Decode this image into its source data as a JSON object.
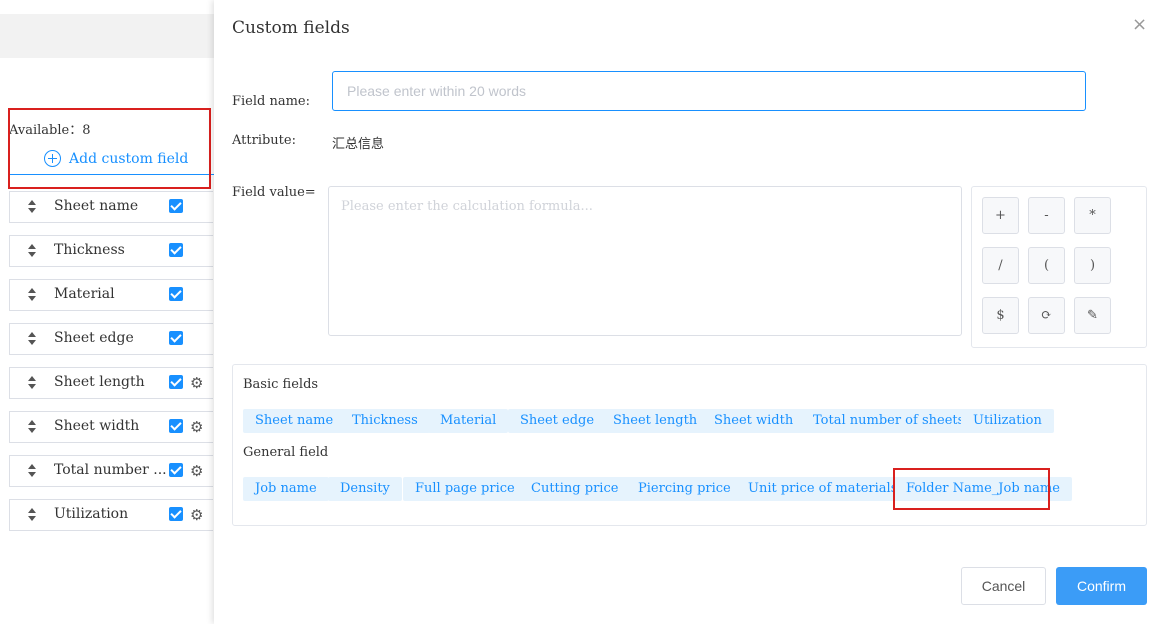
{
  "left_panel": {
    "available_label": "Available：8",
    "add_custom_field_label": "Add custom field",
    "rows": [
      {
        "label": "Sheet name",
        "checked": true,
        "has_gear": false
      },
      {
        "label": "Thickness",
        "checked": true,
        "has_gear": false
      },
      {
        "label": "Material",
        "checked": true,
        "has_gear": false
      },
      {
        "label": "Sheet edge",
        "checked": true,
        "has_gear": false
      },
      {
        "label": "Sheet length",
        "checked": true,
        "has_gear": true
      },
      {
        "label": "Sheet width",
        "checked": true,
        "has_gear": true
      },
      {
        "label": "Total number ...",
        "checked": true,
        "has_gear": true
      },
      {
        "label": "Utilization",
        "checked": true,
        "has_gear": true
      }
    ]
  },
  "dialog": {
    "title": "Custom fields",
    "close_icon": "×",
    "field_name_label": "Field name:",
    "field_name_placeholder": "Please enter within 20 words",
    "field_name_value": "",
    "attribute_label": "Attribute:",
    "attribute_value": "汇总信息",
    "field_value_label": "Field value=",
    "formula_placeholder": "Please enter the calculation formula...",
    "keypad": [
      "+",
      "-",
      "*",
      "/",
      "(",
      ")",
      "$",
      "⟳",
      "✎"
    ],
    "basic_fields_title": "Basic fields",
    "basic_fields": [
      "Sheet name",
      "Thickness",
      "Material",
      "Sheet edge",
      "Sheet length",
      "Sheet width",
      "Total number of sheets",
      "Utilization"
    ],
    "general_field_title": "General field",
    "general_fields": [
      "Job name",
      "Density",
      "Full page price",
      "Cutting price",
      "Piercing price",
      "Unit price of materials",
      "Folder Name_Job name"
    ],
    "cancel_label": "Cancel",
    "confirm_label": "Confirm"
  },
  "colors": {
    "accent": "#1890ff",
    "highlight_box": "#d9201e",
    "tag_bg": "#e6f3fd",
    "confirm_bg": "#3b9cf7"
  }
}
